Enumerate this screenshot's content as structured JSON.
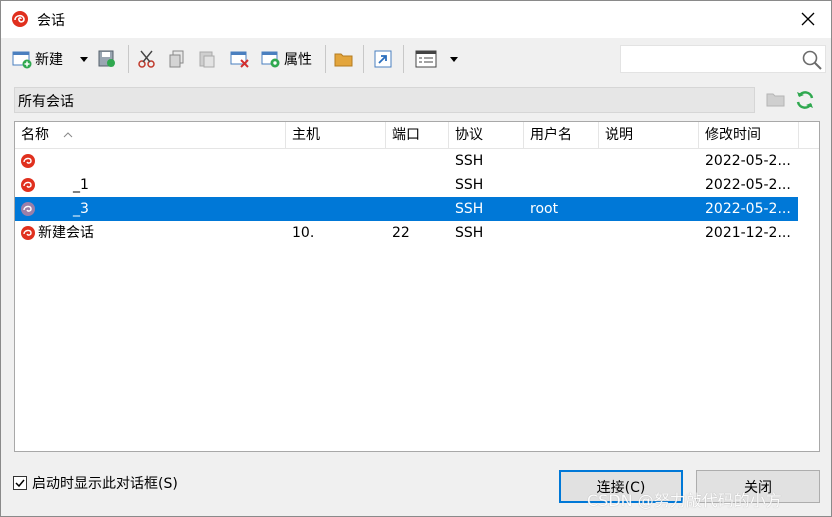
{
  "window": {
    "title": "会话"
  },
  "toolbar": {
    "new_label": "新建",
    "properties_label": "属性"
  },
  "search": {
    "value": "",
    "placeholder": ""
  },
  "path": {
    "label": "所有会话"
  },
  "columns": [
    "名称",
    "主机",
    "端口",
    "协议",
    "用户名",
    "说明",
    "修改时间"
  ],
  "sessions": [
    {
      "name": "",
      "host": "",
      "port": "",
      "protocol": "SSH",
      "user": "",
      "desc": "",
      "modified": "2022-05-2..."
    },
    {
      "name": "_1",
      "host": "",
      "port": "",
      "protocol": "SSH",
      "user": "",
      "desc": "",
      "modified": "2022-05-2..."
    },
    {
      "name": "_3",
      "host": "",
      "port": "",
      "protocol": "SSH",
      "user": "root",
      "desc": "",
      "modified": "2022-05-2..."
    },
    {
      "name": "新建会话",
      "host": "10.",
      "port": "22",
      "protocol": "SSH",
      "user": "",
      "desc": "",
      "modified": "2021-12-2..."
    }
  ],
  "footer": {
    "startup_label": "启动时显示此对话框(S)",
    "connect_label": "连接(C)",
    "close_label": "关闭"
  },
  "watermark": "CSDN @努力敲代码的小方",
  "colors": {
    "selection": "#0078d7",
    "brand": "#e0301e"
  }
}
